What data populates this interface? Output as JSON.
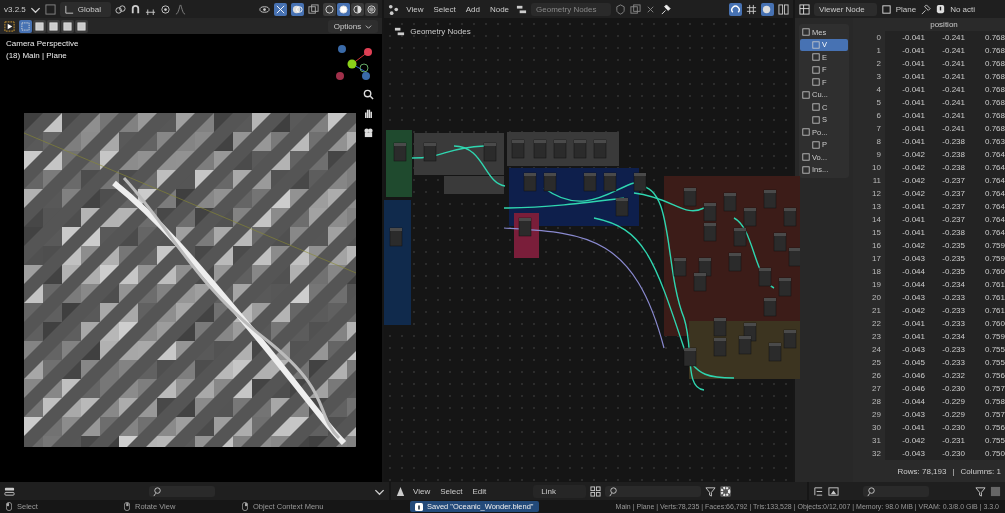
{
  "viewport": {
    "header": {
      "version": "v3.2.5",
      "orientation": "Global",
      "shading_modes": [
        {
          "selected": false
        },
        {
          "selected": true
        },
        {
          "selected": false
        },
        {
          "selected": false
        }
      ]
    },
    "tool_header": {
      "select_modes": [
        {
          "selected": true
        },
        {
          "selected": false
        },
        {
          "selected": false
        },
        {
          "selected": false
        },
        {
          "selected": false
        }
      ],
      "options": "Options"
    },
    "overlay_text": [
      "Camera Perspective",
      "(18) Main | Plane"
    ]
  },
  "node_editor": {
    "menus": [
      "View",
      "Select",
      "Add",
      "Node"
    ],
    "node_group": "Geometry Nodes",
    "breadcrumb": "Geometry Nodes"
  },
  "spreadsheet": {
    "viewer": "Viewer Node",
    "object": "Plane",
    "status": "No acti",
    "sidebar": [
      {
        "label": "Mes",
        "selected": false,
        "children": [
          {
            "label": "V",
            "selected": true
          },
          {
            "label": "E",
            "selected": false
          },
          {
            "label": "F",
            "selected": false
          },
          {
            "label": "F",
            "selected": false
          }
        ]
      },
      {
        "label": "Cu...",
        "selected": false,
        "children": [
          {
            "label": "C",
            "selected": false
          },
          {
            "label": "S",
            "selected": false
          }
        ]
      },
      {
        "label": "Po...",
        "selected": false,
        "children": [
          {
            "label": "P",
            "selected": false
          }
        ]
      },
      {
        "label": "Vo...",
        "selected": false
      },
      {
        "label": "Ins...",
        "selected": false
      }
    ],
    "column": "position",
    "rows": [
      {
        "index": "0",
        "values": [
          "-0.041",
          "-0.241",
          "0.768"
        ]
      },
      {
        "index": "1",
        "values": [
          "-0.041",
          "-0.241",
          "0.768"
        ]
      },
      {
        "index": "2",
        "values": [
          "-0.041",
          "-0.241",
          "0.768"
        ]
      },
      {
        "index": "3",
        "values": [
          "-0.041",
          "-0.241",
          "0.768"
        ]
      },
      {
        "index": "4",
        "values": [
          "-0.041",
          "-0.241",
          "0.768"
        ]
      },
      {
        "index": "5",
        "values": [
          "-0.041",
          "-0.241",
          "0.768"
        ]
      },
      {
        "index": "6",
        "values": [
          "-0.041",
          "-0.241",
          "0.768"
        ]
      },
      {
        "index": "7",
        "values": [
          "-0.041",
          "-0.241",
          "0.768"
        ]
      },
      {
        "index": "8",
        "values": [
          "-0.041",
          "-0.238",
          "0.763"
        ]
      },
      {
        "index": "9",
        "values": [
          "-0.042",
          "-0.238",
          "0.764"
        ]
      },
      {
        "index": "10",
        "values": [
          "-0.042",
          "-0.238",
          "0.764"
        ]
      },
      {
        "index": "11",
        "values": [
          "-0.042",
          "-0.237",
          "0.764"
        ]
      },
      {
        "index": "12",
        "values": [
          "-0.042",
          "-0.237",
          "0.764"
        ]
      },
      {
        "index": "13",
        "values": [
          "-0.041",
          "-0.237",
          "0.764"
        ]
      },
      {
        "index": "14",
        "values": [
          "-0.041",
          "-0.237",
          "0.764"
        ]
      },
      {
        "index": "15",
        "values": [
          "-0.041",
          "-0.238",
          "0.764"
        ]
      },
      {
        "index": "16",
        "values": [
          "-0.042",
          "-0.235",
          "0.759"
        ]
      },
      {
        "index": "17",
        "values": [
          "-0.043",
          "-0.235",
          "0.759"
        ]
      },
      {
        "index": "18",
        "values": [
          "-0.044",
          "-0.235",
          "0.760"
        ]
      },
      {
        "index": "19",
        "values": [
          "-0.044",
          "-0.234",
          "0.761"
        ]
      },
      {
        "index": "20",
        "values": [
          "-0.043",
          "-0.233",
          "0.761"
        ]
      },
      {
        "index": "21",
        "values": [
          "-0.042",
          "-0.233",
          "0.761"
        ]
      },
      {
        "index": "22",
        "values": [
          "-0.041",
          "-0.233",
          "0.760"
        ]
      },
      {
        "index": "23",
        "values": [
          "-0.041",
          "-0.234",
          "0.759"
        ]
      },
      {
        "index": "24",
        "values": [
          "-0.043",
          "-0.233",
          "0.755"
        ]
      },
      {
        "index": "25",
        "values": [
          "-0.045",
          "-0.233",
          "0.755"
        ]
      },
      {
        "index": "26",
        "values": [
          "-0.046",
          "-0.232",
          "0.756"
        ]
      },
      {
        "index": "27",
        "values": [
          "-0.046",
          "-0.230",
          "0.757"
        ]
      },
      {
        "index": "28",
        "values": [
          "-0.044",
          "-0.229",
          "0.758"
        ]
      },
      {
        "index": "29",
        "values": [
          "-0.043",
          "-0.229",
          "0.757"
        ]
      },
      {
        "index": "30",
        "values": [
          "-0.041",
          "-0.230",
          "0.756"
        ]
      },
      {
        "index": "31",
        "values": [
          "-0.042",
          "-0.231",
          "0.755"
        ]
      },
      {
        "index": "32",
        "values": [
          "-0.043",
          "-0.230",
          "0.750"
        ]
      }
    ],
    "footer": {
      "rows": "Rows: 78,193",
      "separator": "|",
      "columns": "Columns: 1"
    }
  },
  "bottom": {
    "node_menus": [
      "View",
      "Select",
      "Edit"
    ],
    "link_mode": "Link"
  },
  "status_bar": {
    "hints": [
      "Select",
      "Rotate View",
      "Object Context Menu"
    ],
    "message": "Saved \"Oceanic_Wonder.blend\"",
    "stats": "Main | Plane | Verts:78,235 | Faces:66,792 | Tris:133,528 | Objects:0/12,007 | Memory: 98.0 MiB | VRAM: 0.3/8.0 GiB | 3.3.0"
  }
}
